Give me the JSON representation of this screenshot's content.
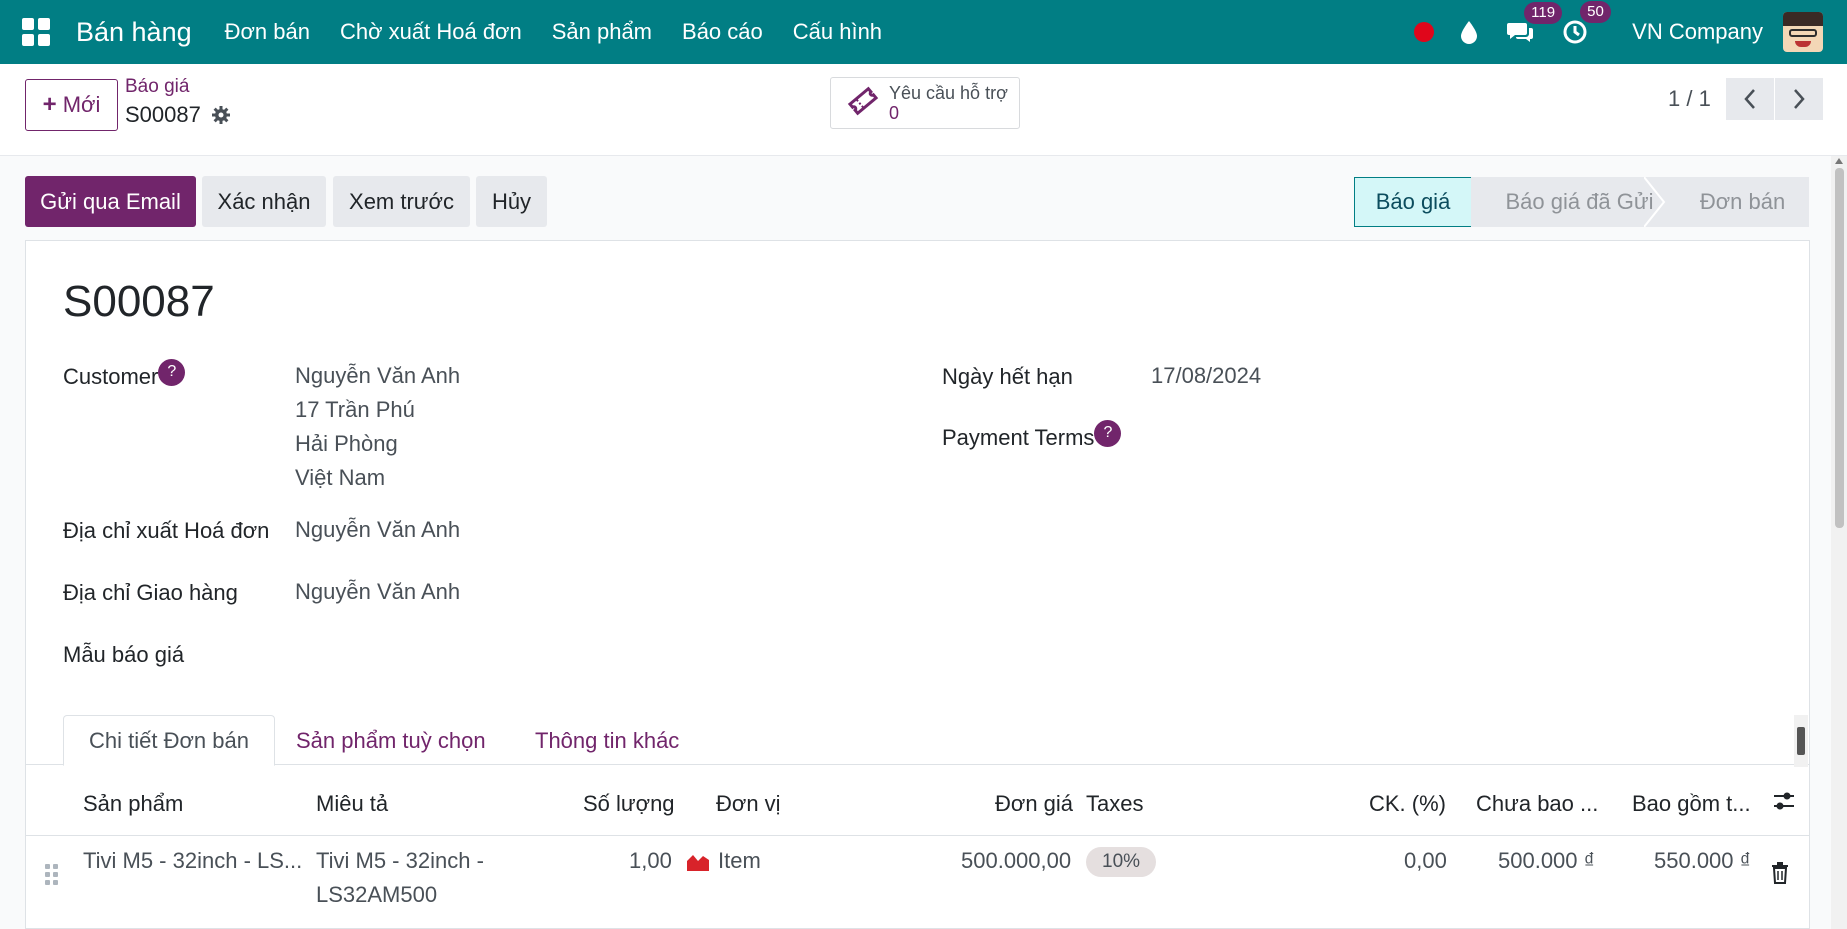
{
  "navbar": {
    "brand": "Bán hàng",
    "menu": [
      "Đơn bán",
      "Chờ xuất Hoá đơn",
      "Sản phẩm",
      "Báo cáo",
      "Cấu hình"
    ],
    "messages_badge": "119",
    "activities_badge": "50",
    "company": "VN Company"
  },
  "control": {
    "new_label": "Mới",
    "breadcrumb_parent": "Báo giá",
    "breadcrumb_current": "S00087",
    "support_label": "Yêu cầu hỗ trợ",
    "support_count": "0",
    "pager": "1 / 1"
  },
  "actions": {
    "send_email": "Gửi qua Email",
    "confirm": "Xác nhận",
    "preview": "Xem trước",
    "cancel": "Hủy"
  },
  "stages": {
    "items": [
      "Báo giá",
      "Báo giá đã Gửi",
      "Đơn bán"
    ],
    "active": "Báo giá"
  },
  "record": {
    "name": "S00087",
    "customer_label": "Customer",
    "customer_lines": [
      "Nguyễn Văn Anh",
      "17 Trần Phú",
      "Hải Phòng",
      "Việt Nam"
    ],
    "invoice_address_label": "Địa chỉ xuất Hoá đơn",
    "invoice_address": "Nguyễn Văn Anh",
    "delivery_address_label": "Địa chỉ Giao hàng",
    "delivery_address": "Nguyễn Văn Anh",
    "quote_template_label": "Mẫu báo giá",
    "expiration_label": "Ngày hết hạn",
    "expiration": "17/08/2024",
    "payment_terms_label": "Payment Terms",
    "help_mark": "?"
  },
  "tabs": [
    "Chi tiết Đơn bán",
    "Sản phẩm tuỳ chọn",
    "Thông tin khác"
  ],
  "table": {
    "headers": [
      "Sản phẩm",
      "Miêu tả",
      "Số lượng",
      "Đơn vị",
      "Đơn giá",
      "Taxes",
      "CK. (%)",
      "Chưa bao ...",
      "Bao gồm t..."
    ],
    "rows": [
      {
        "product": "Tivi M5 - 32inch - LS...",
        "description_line1": "Tivi M5 - 32inch -",
        "description_line2": "LS32AM500",
        "quantity": "1,00",
        "uom": "Item",
        "price": "500.000,00",
        "tax": "10%",
        "discount": "0,00",
        "subtotal": "500.000 ₫",
        "total": "550.000 ₫"
      }
    ]
  },
  "colors": {
    "navbar": "#017e84",
    "primary": "#71256b",
    "active_stage_bg": "#d4f7f8",
    "record_dot": "#e0061b"
  }
}
